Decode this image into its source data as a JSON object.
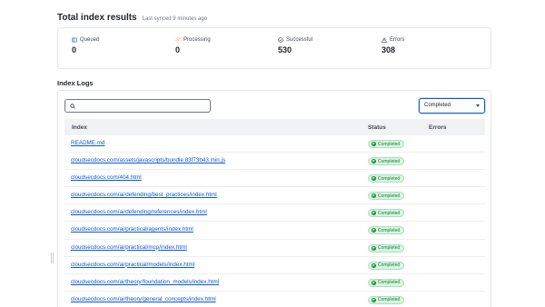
{
  "header": {
    "title": "Total index results",
    "sync_text": "Last synced 9 minutes ago"
  },
  "stats": [
    {
      "label": "Queued",
      "value": "0",
      "icon": "queued-icon"
    },
    {
      "label": "Processing",
      "value": "0",
      "icon": "processing-icon"
    },
    {
      "label": "Successful",
      "value": "530",
      "icon": "check-circle-icon"
    },
    {
      "label": "Errors",
      "value": "308",
      "icon": "warning-icon"
    }
  ],
  "logs": {
    "title": "Index Logs",
    "search_placeholder": "",
    "filter_value": "Completed",
    "columns": {
      "index": "Index",
      "status": "Status",
      "errors": "Errors"
    },
    "rows": [
      {
        "index": "README.md",
        "status": "Completed",
        "errors": ""
      },
      {
        "index": "cloudsecdocs.com/assets/javascripts/bundle.83f73b43.min.js",
        "status": "Completed",
        "errors": ""
      },
      {
        "index": "cloudsecdocs.com/404.html",
        "status": "Completed",
        "errors": ""
      },
      {
        "index": "cloudsecdocs.com/ai/defending/best_practices/index.html",
        "status": "Completed",
        "errors": ""
      },
      {
        "index": "cloudsecdocs.com/ai/defending/references/index.html",
        "status": "Completed",
        "errors": ""
      },
      {
        "index": "cloudsecdocs.com/ai/practical/agents/index.html",
        "status": "Completed",
        "errors": ""
      },
      {
        "index": "cloudsecdocs.com/ai/practical/mcp/index.html",
        "status": "Completed",
        "errors": ""
      },
      {
        "index": "cloudsecdocs.com/ai/practical/models/index.html",
        "status": "Completed",
        "errors": ""
      },
      {
        "index": "cloudsecdocs.com/ai/theory/foundation_models/index.html",
        "status": "Completed",
        "errors": ""
      },
      {
        "index": "cloudsecdocs.com/ai/theory/general_concepts/index.html",
        "status": "Completed",
        "errors": ""
      }
    ]
  },
  "colors": {
    "accent": "#0b57d0",
    "success_bg": "#d8f5e1",
    "success_text": "#1a7f37"
  }
}
